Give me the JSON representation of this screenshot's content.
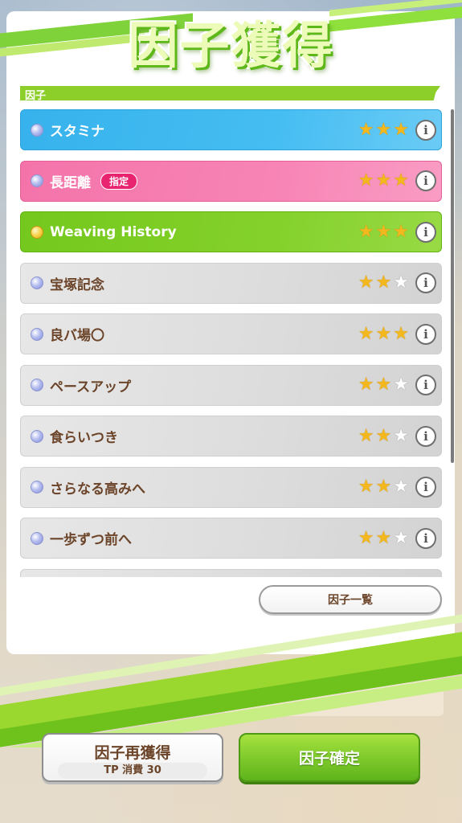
{
  "header": {
    "title": "因子獲得"
  },
  "section": {
    "label": "因子"
  },
  "factors": [
    {
      "name": "スタミナ",
      "color": "blue",
      "stars": 3,
      "tag": ""
    },
    {
      "name": "長距離",
      "color": "pink",
      "stars": 3,
      "tag": "指定"
    },
    {
      "name": "Weaving History",
      "color": "green",
      "stars": 3,
      "tag": ""
    },
    {
      "name": "宝塚記念",
      "color": "gray",
      "stars": 2,
      "tag": ""
    },
    {
      "name": "良バ場〇",
      "color": "gray",
      "stars": 3,
      "tag": ""
    },
    {
      "name": "ペースアップ",
      "color": "gray",
      "stars": 2,
      "tag": ""
    },
    {
      "name": "食らいつき",
      "color": "gray",
      "stars": 2,
      "tag": ""
    },
    {
      "name": "さらなる高みへ",
      "color": "gray",
      "stars": 2,
      "tag": ""
    },
    {
      "name": "一歩ずつ前へ",
      "color": "gray",
      "stars": 2,
      "tag": ""
    },
    {
      "name": "",
      "color": "gray",
      "stars": 0,
      "tag": ""
    }
  ],
  "list_button": {
    "label": "因子一覧"
  },
  "buttons": {
    "regain_label": "因子再獲得",
    "regain_cost": "TP 消費 30",
    "confirm_label": "因子確定"
  },
  "colors": {
    "accent_green": "#7cc82a",
    "blue_row": "#45bdf2",
    "pink_row": "#f784b5",
    "tag_pink": "#e82370",
    "star_gold": "#f4b81f",
    "text_brown": "#6b4429"
  }
}
